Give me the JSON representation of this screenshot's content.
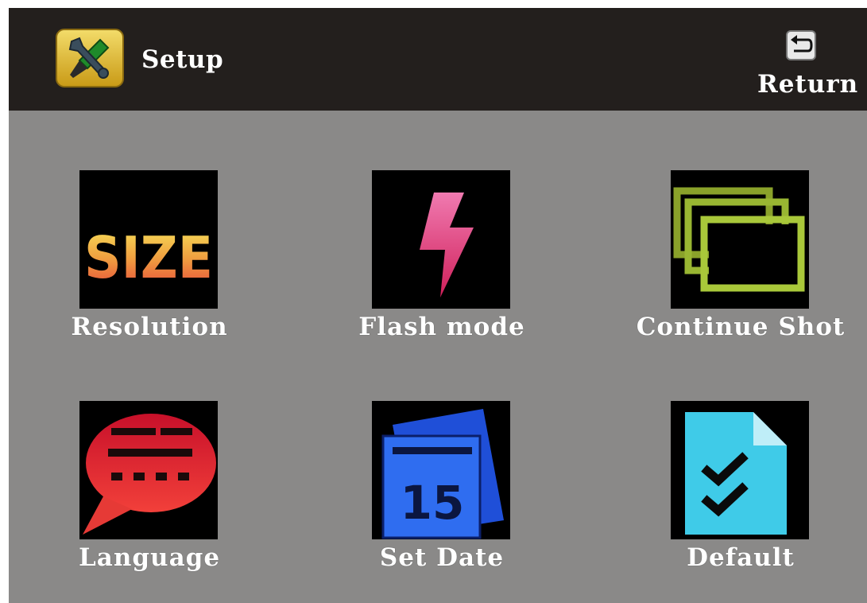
{
  "header": {
    "title": "Setup",
    "app_icon": "tools-icon",
    "return_label": "Return",
    "return_icon": "return-arrow-icon"
  },
  "menu": [
    {
      "label": "Resolution",
      "icon": "size-icon",
      "icon_text": "SIZE"
    },
    {
      "label": "Flash mode",
      "icon": "flash-icon"
    },
    {
      "label": "Continue Shot",
      "icon": "stacked-frames-icon"
    },
    {
      "label": "Language",
      "icon": "speech-bubble-icon"
    },
    {
      "label": "Set Date",
      "icon": "calendar-icon",
      "icon_text": "15"
    },
    {
      "label": "Default",
      "icon": "checklist-document-icon"
    }
  ],
  "colors": {
    "header_bg": "#231f1d",
    "body_bg": "#8a8988",
    "label_text": "#ffffff"
  }
}
